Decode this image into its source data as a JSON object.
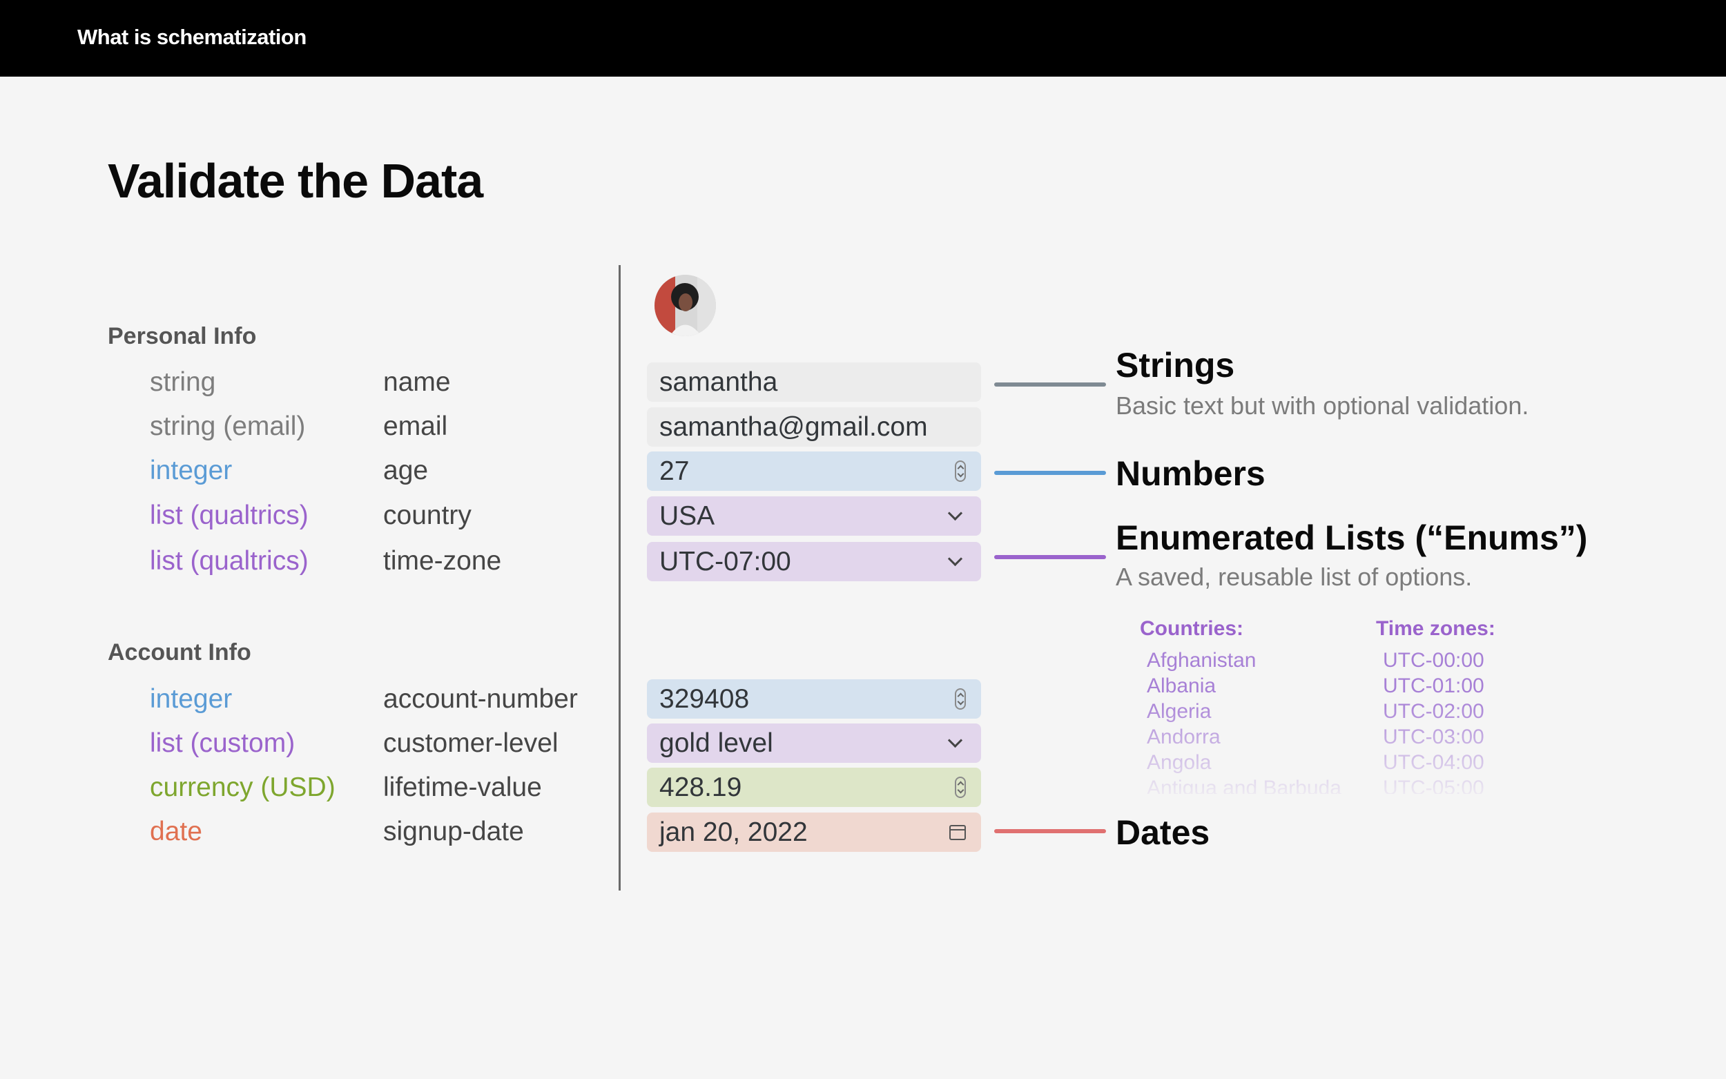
{
  "header": {
    "title": "What is schematization"
  },
  "page": {
    "title": "Validate the Data"
  },
  "colors": {
    "string": "#7d7d7d",
    "integer": "#5a9bd5",
    "list": "#9a63cc",
    "currency": "#7ea62e",
    "date": "#e07050"
  },
  "personal": {
    "title": "Personal Info",
    "rows": [
      {
        "type": "string",
        "field": "name",
        "value": "samantha",
        "control": "text"
      },
      {
        "type": "string (email)",
        "field": "email",
        "value": "samantha@gmail.com",
        "control": "text"
      },
      {
        "type": "integer",
        "field": "age",
        "value": "27",
        "control": "stepper"
      },
      {
        "type": "list (qualtrics)",
        "field": "country",
        "value": "USA",
        "control": "dropdown"
      },
      {
        "type": "list (qualtrics)",
        "field": "time-zone",
        "value": "UTC-07:00",
        "control": "dropdown"
      }
    ]
  },
  "account": {
    "title": "Account Info",
    "rows": [
      {
        "type": "integer",
        "field": "account-number",
        "value": "329408",
        "control": "stepper"
      },
      {
        "type": "list (custom)",
        "field": "customer-level",
        "value": "gold level",
        "control": "dropdown"
      },
      {
        "type": "currency (USD)",
        "field": "lifetime-value",
        "value": "428.19",
        "control": "stepper"
      },
      {
        "type": "date",
        "field": "signup-date",
        "value": "jan 20, 2022",
        "control": "date-picker"
      }
    ]
  },
  "annotations": {
    "strings": {
      "title": "Strings",
      "desc": "Basic text but with optional validation.",
      "color": "#7f8a93"
    },
    "numbers": {
      "title": "Numbers",
      "color": "#5a9bd5"
    },
    "enums": {
      "title": "Enumerated Lists (“Enums”)",
      "desc": "A saved, reusable list of options.",
      "color": "#9a63cc"
    },
    "dates": {
      "title": "Dates",
      "color": "#e07070"
    }
  },
  "lists": {
    "countries": {
      "title": "Countries:",
      "items": [
        "Afghanistan",
        "Albania",
        "Algeria",
        "Andorra",
        "Angola",
        "Antigua and Barbuda"
      ]
    },
    "timezones": {
      "title": "Time zones:",
      "items": [
        "UTC-00:00",
        "UTC-01:00",
        "UTC-02:00",
        "UTC-03:00",
        "UTC-04:00",
        "UTC-05:00"
      ]
    }
  }
}
